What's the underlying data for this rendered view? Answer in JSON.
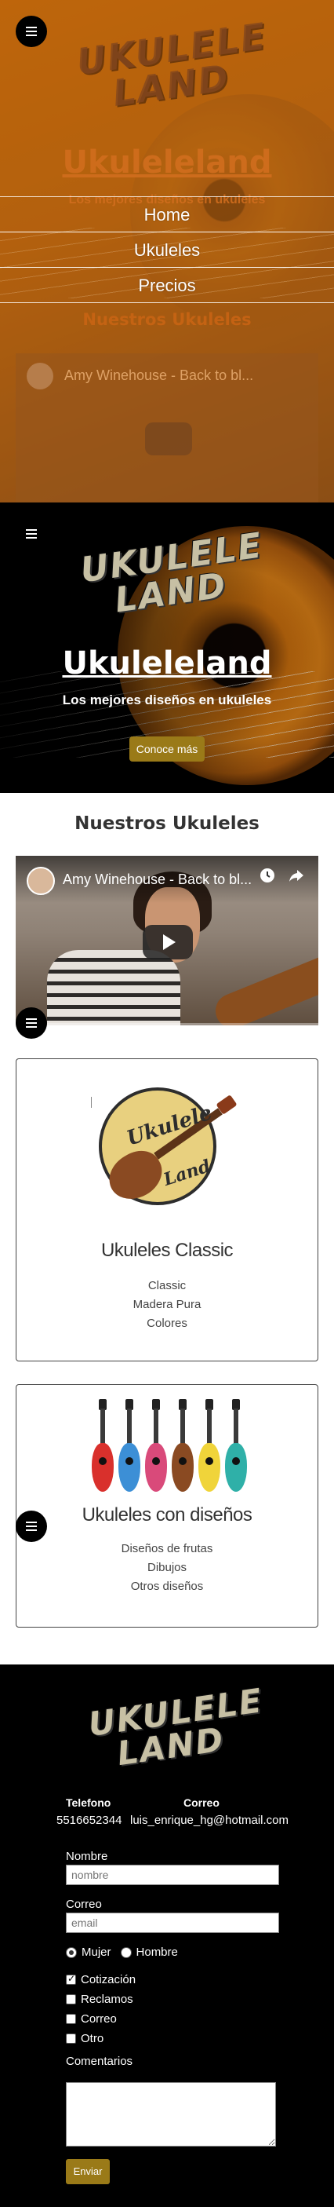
{
  "brand": {
    "logo_line1": "UKULELE",
    "logo_line2": "LAND"
  },
  "nav": {
    "items": [
      {
        "label": "Home"
      },
      {
        "label": "Ukuleles"
      },
      {
        "label": "Precios"
      }
    ]
  },
  "hero": {
    "title": "Ukuleleland",
    "subtitle": "Los mejores diseños en ukuleles",
    "cta_label": "Conoce más"
  },
  "ukuleles": {
    "section_title": "Nuestros Ukuleles",
    "video": {
      "title": "Amy Winehouse - Back to bl...",
      "icons": [
        "clock-icon",
        "share-icon",
        "play-icon"
      ]
    },
    "cards": [
      {
        "badge_line1": "Ukulele",
        "badge_line2": "Land",
        "title": "Ukuleles Classic",
        "lines": [
          "Classic",
          "Madera Pura",
          "Colores"
        ]
      },
      {
        "title": "Ukuleles con diseños",
        "lines": [
          "Diseños de frutas",
          "Dibujos",
          "Otros diseños"
        ]
      }
    ]
  },
  "contact": {
    "phone_label": "Telefono",
    "phone_value": "5516652344",
    "email_label": "Correo",
    "email_value": "luis_enrique_hg@hotmail.com"
  },
  "form": {
    "name_label": "Nombre",
    "name_placeholder": "nombre",
    "email_label": "Correo",
    "email_placeholder": "email",
    "gender_options": [
      {
        "label": "Mujer",
        "selected": true
      },
      {
        "label": "Hombre",
        "selected": false
      }
    ],
    "interest_options": [
      {
        "label": "Cotización",
        "checked": true
      },
      {
        "label": "Reclamos",
        "checked": false
      },
      {
        "label": "Correo",
        "checked": false
      },
      {
        "label": "Otro",
        "checked": false
      }
    ],
    "comments_label": "Comentarios",
    "submit_label": "Enviar"
  },
  "colors": {
    "accent": "#9a7a18",
    "overlay": "#b86207",
    "footer_bg": "#000000"
  }
}
